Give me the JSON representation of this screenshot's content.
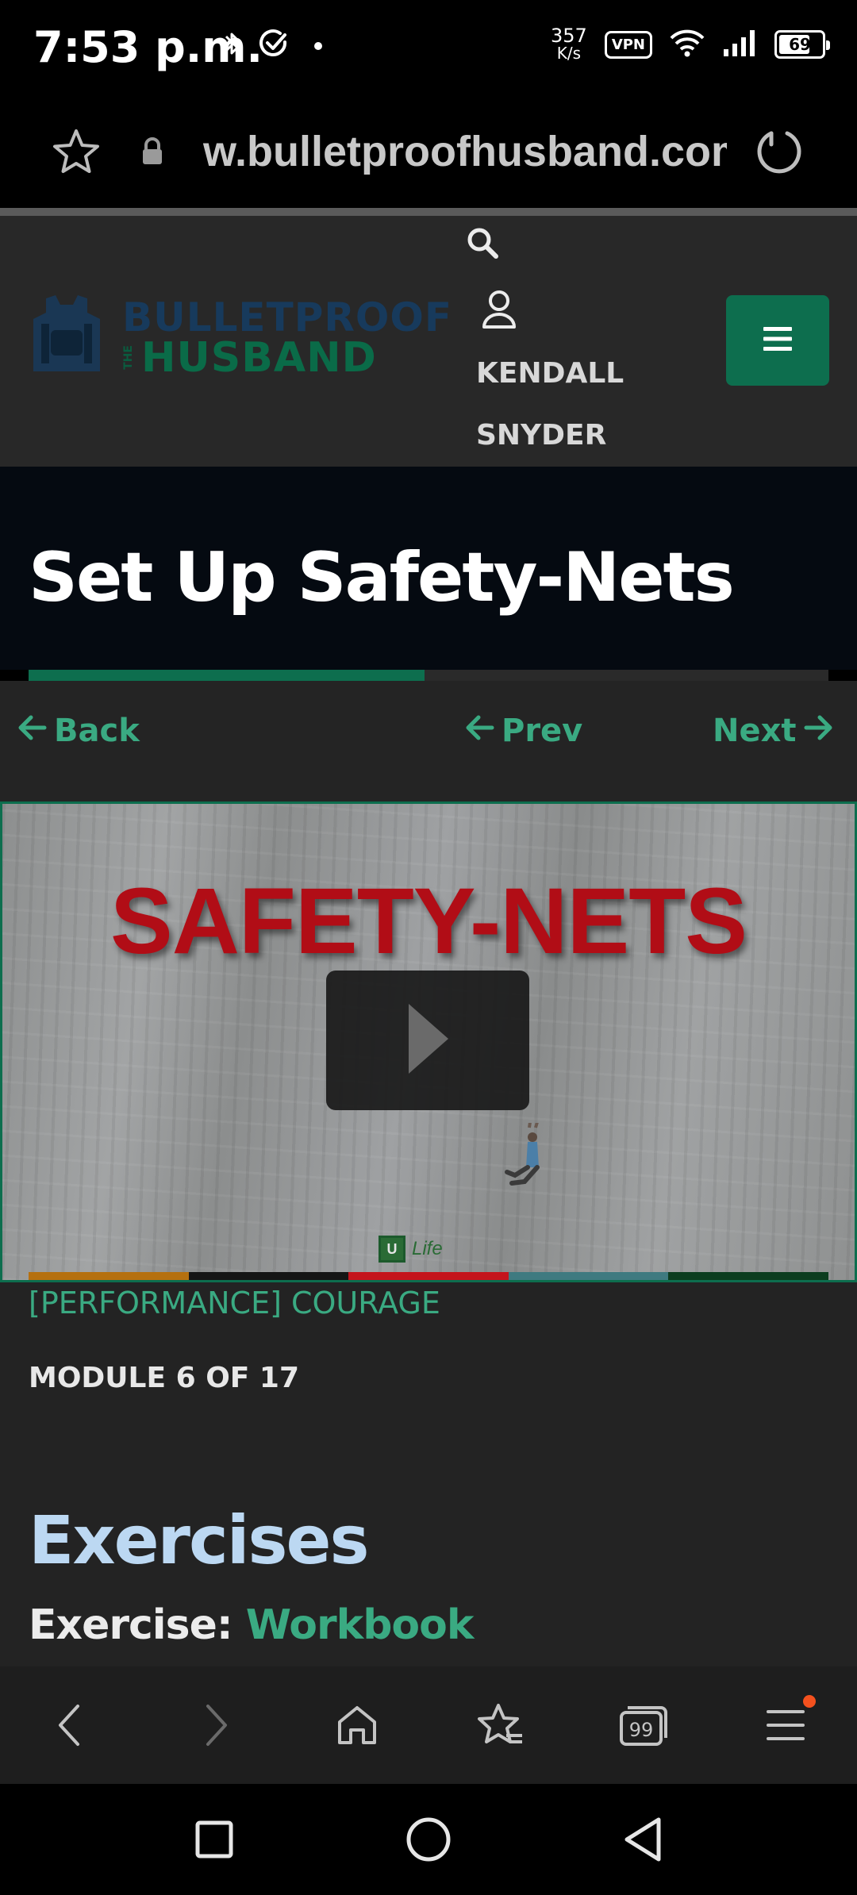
{
  "status_bar": {
    "time": "7:53 p.m.",
    "net_speed_value": "357",
    "net_speed_unit": "K/s",
    "vpn_label": "VPN",
    "battery_level": "69"
  },
  "url_bar": {
    "url": "w.bulletproofhusband.com"
  },
  "site_header": {
    "logo_top": "BULLETPROOF",
    "logo_the": "THE",
    "logo_bottom": "HUSBAND",
    "user_name": "KENDALL SNYDER"
  },
  "lesson": {
    "title": "Set Up Safety-Nets",
    "progress_percent": 49.5
  },
  "nav": {
    "back_label": "Back",
    "prev_label": "Prev",
    "next_label": "Next"
  },
  "video": {
    "title": "SAFETY-NETS",
    "logo_mark": "U",
    "logo_text": "Life",
    "stripe_colors": [
      "#b5700f",
      "#151515",
      "#c4141c",
      "#3f7a80",
      "#0c3d1f"
    ]
  },
  "content": {
    "course_link": "[PERFORMANCE] COURAGE",
    "module_count": "MODULE 6 OF 17",
    "section_heading": "Exercises",
    "exercise_label": "Exercise: ",
    "exercise_value": "Workbook"
  },
  "colors": {
    "accent_green": "#3aaa82",
    "brand_green": "#0d6e4e",
    "notification": "#f4511e"
  },
  "icons": {
    "status": [
      "bluetooth-icon",
      "check-circle-icon",
      "dot-icon",
      "wifi-icon",
      "signal-icon",
      "battery-icon"
    ],
    "url_bar": [
      "star-icon",
      "lock-icon",
      "reload-icon"
    ],
    "toolbar": [
      "back-arrow-icon",
      "forward-arrow-icon",
      "home-icon",
      "bookmarks-icon",
      "tabs-icon",
      "menu-icon"
    ],
    "system": [
      "recents-icon",
      "home-circle-icon",
      "back-triangle-icon"
    ]
  }
}
